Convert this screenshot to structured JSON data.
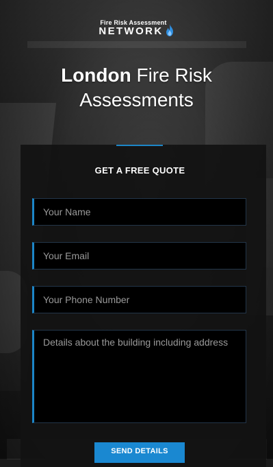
{
  "brand": {
    "tagline": "Fire Risk Assessment",
    "name": "NETWORK",
    "icon": "flame-icon",
    "accent_color": "#1c86c8"
  },
  "hero": {
    "bold": "London",
    "rest_line1": "Fire Risk",
    "line2": "Assessments"
  },
  "form": {
    "title": "GET A FREE QUOTE",
    "name_placeholder": "Your Name",
    "email_placeholder": "Your Email",
    "phone_placeholder": "Your Phone Number",
    "details_placeholder": "Details about the building including address",
    "submit_label": "SEND DETAILS",
    "submit_color": "#1a88d1"
  }
}
